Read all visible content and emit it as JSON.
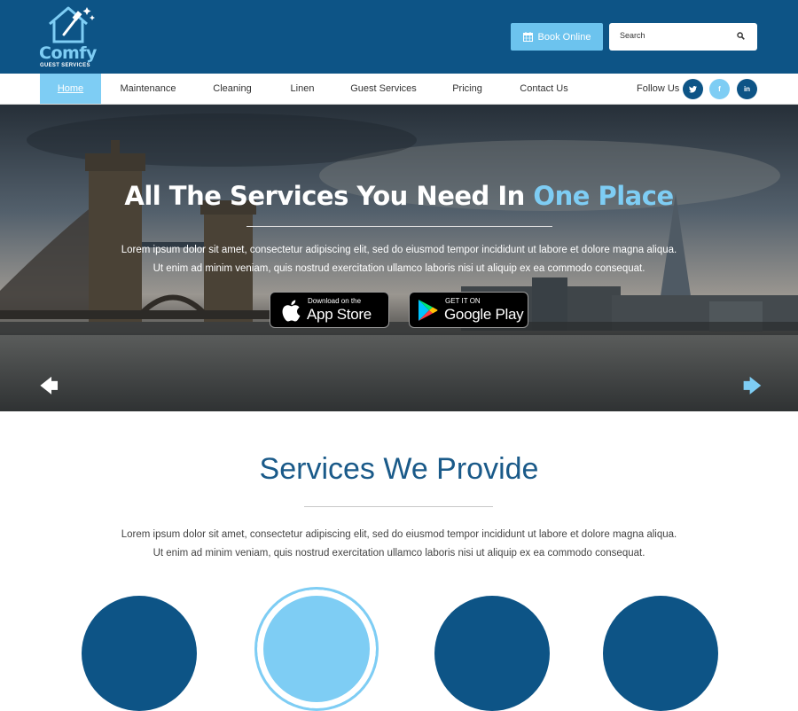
{
  "brand": {
    "name": "Comfy",
    "tagline": "GUEST SERVICES",
    "logo_icon": "house-squeegee-icon"
  },
  "header": {
    "book_label": "Book Online",
    "book_icon": "calendar-icon",
    "search_placeholder": "Search"
  },
  "nav": {
    "items": [
      {
        "label": "Home",
        "active": true
      },
      {
        "label": "Maintenance"
      },
      {
        "label": "Cleaning"
      },
      {
        "label": "Linen"
      },
      {
        "label": "Guest Services"
      },
      {
        "label": "Pricing"
      },
      {
        "label": "Contact Us"
      }
    ],
    "follow_label": "Follow Us",
    "social": [
      {
        "name": "twitter",
        "glyph": "t",
        "color": "#0d5486"
      },
      {
        "name": "facebook",
        "glyph": "f",
        "color": "#7ecdf4"
      },
      {
        "name": "linkedin",
        "glyph": "in",
        "color": "#0d5486"
      }
    ]
  },
  "hero": {
    "title_main": "All The Services You Need In ",
    "title_highlight": "One Place",
    "text_line1": "Lorem ipsum dolor sit amet, consectetur adipiscing elit, sed do eiusmod tempor incididunt ut labore et dolore magna aliqua.",
    "text_line2": "Ut enim ad minim veniam, quis nostrud exercitation ullamco laboris nisi ut aliquip ex ea commodo consequat.",
    "app_store": {
      "small": "Download on the",
      "big": "App Store"
    },
    "google_play": {
      "small": "GET IT ON",
      "big": "Google Play"
    },
    "prev_arrow": "🡄",
    "next_arrow": "🡆"
  },
  "services": {
    "title": "Services We Provide",
    "text_line1": "Lorem ipsum dolor sit amet, consectetur adipiscing elit, sed do eiusmod tempor incididunt ut labore et dolore magna aliqua.",
    "text_line2": "Ut enim ad minim veniam, quis nostrud exercitation ullamco laboris nisi ut aliquip ex ea commodo consequat."
  },
  "colors": {
    "primary": "#0d5486",
    "accent": "#7ecdf4"
  }
}
